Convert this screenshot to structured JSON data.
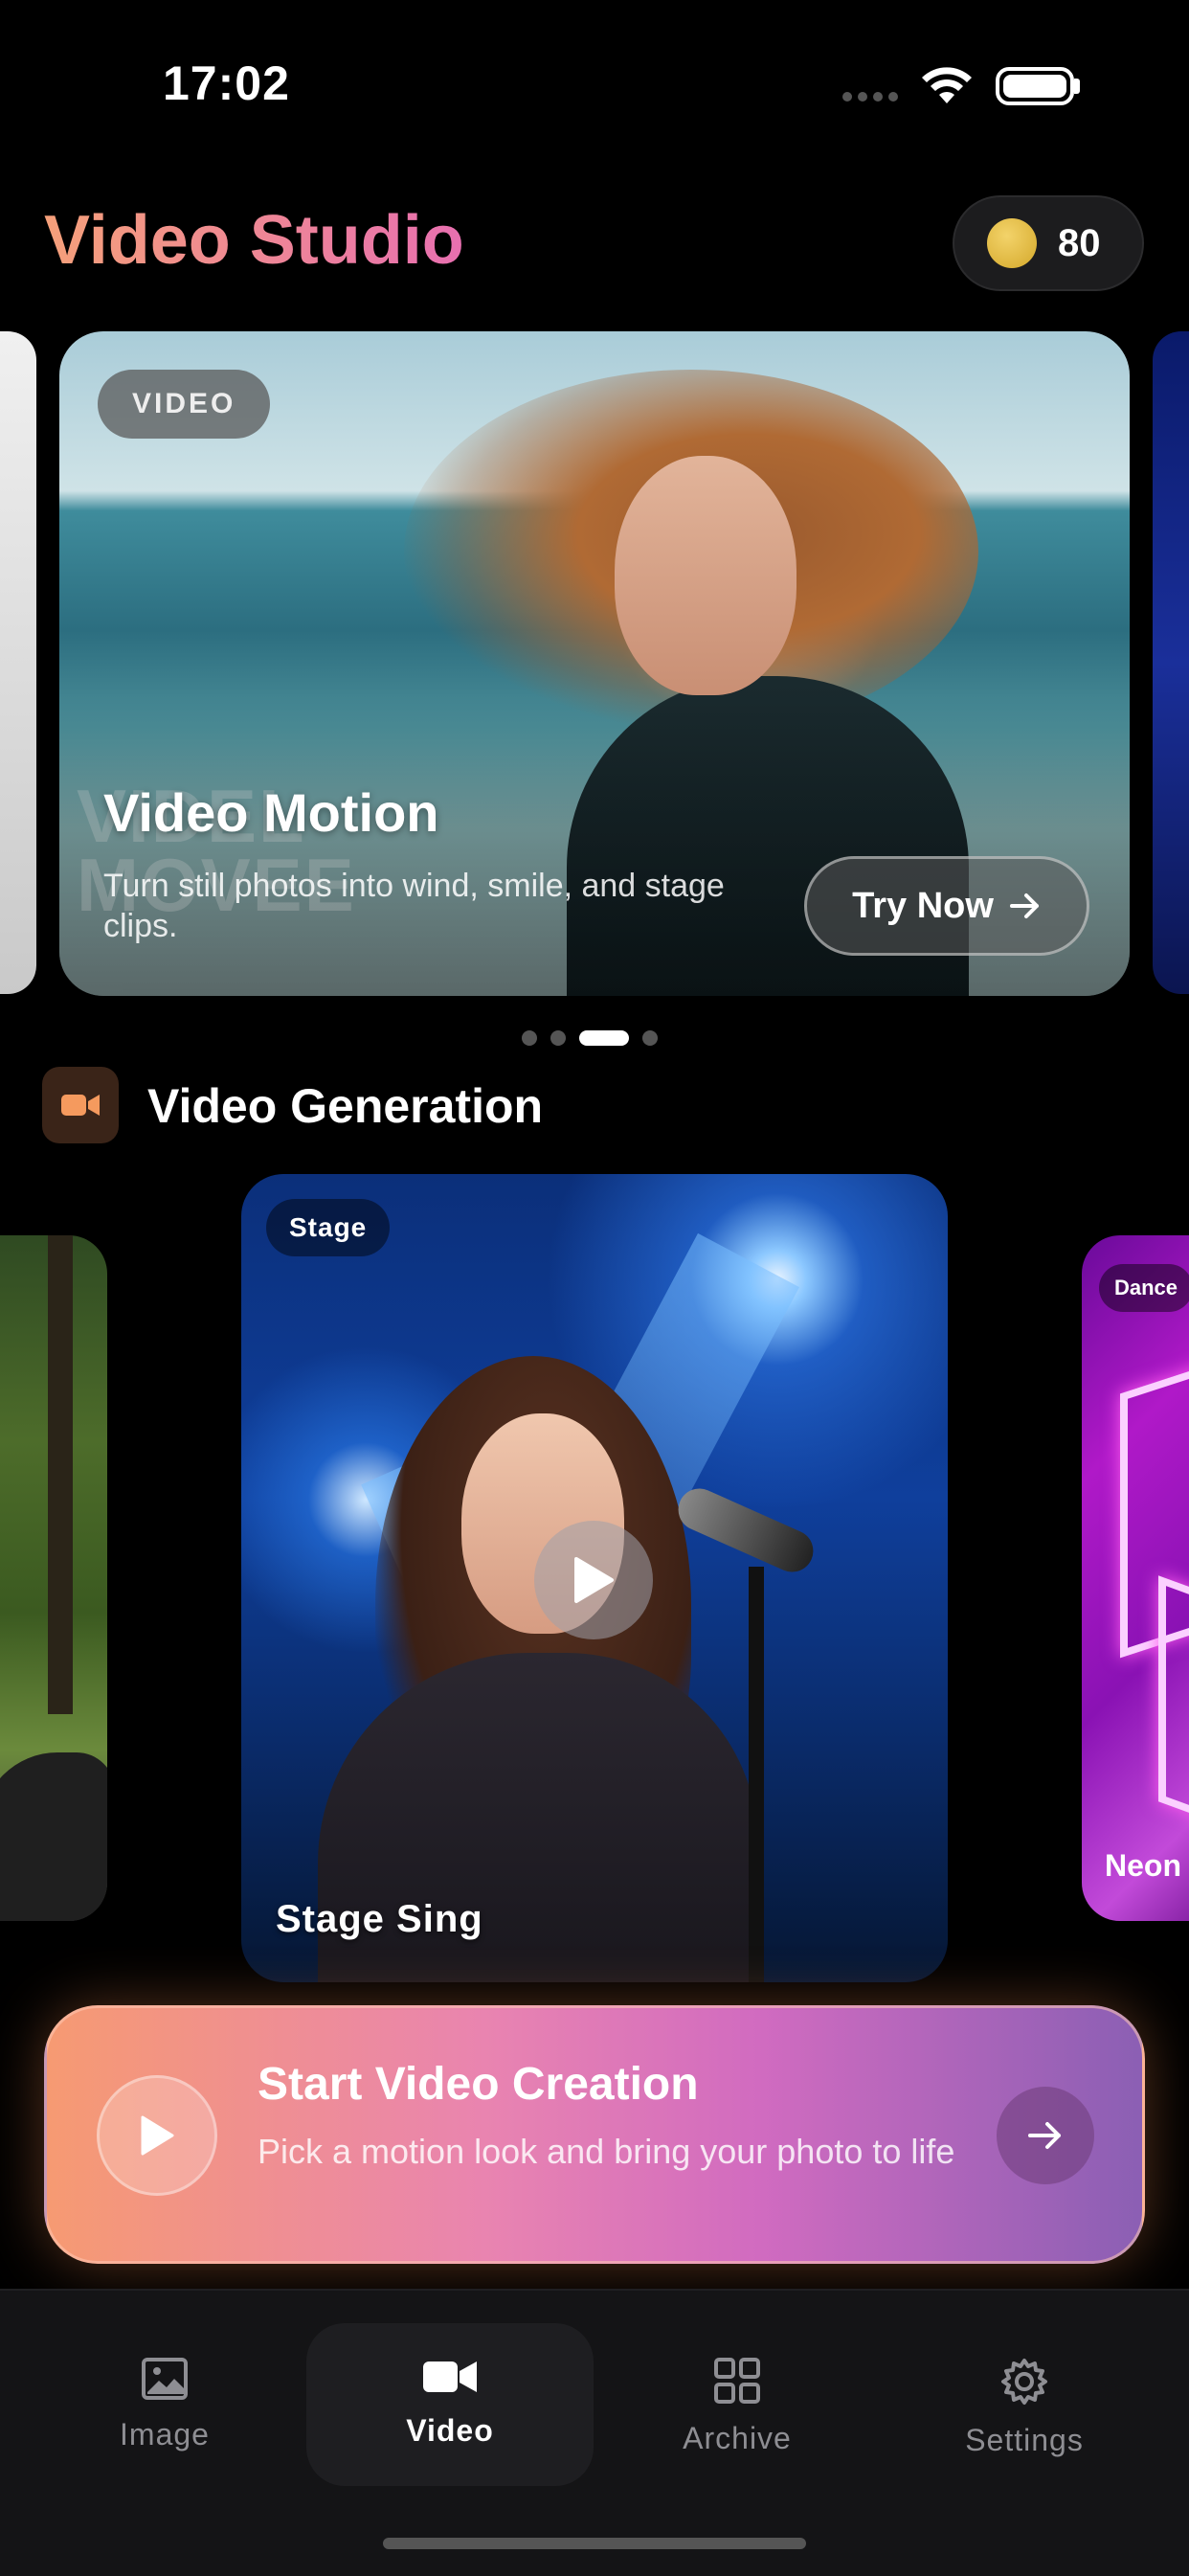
{
  "status_bar": {
    "time": "17:02"
  },
  "header": {
    "title": "Video Studio",
    "coins": "80"
  },
  "hero": {
    "tag": "VIDEO",
    "watermark_line1": "VIDEL",
    "watermark_line2": "MOVEE",
    "title": "Video Motion",
    "subtitle": "Turn still photos into wind, smile, and stage clips.",
    "button_label": "Try Now",
    "page_count": 4,
    "active_page": 3
  },
  "section": {
    "title": "Video Generation"
  },
  "video_cards": {
    "main": {
      "tag": "Stage",
      "name": "Stage Sing"
    },
    "right": {
      "tag": "Dance",
      "name": "Neon Pa"
    }
  },
  "cta": {
    "title": "Start Video Creation",
    "subtitle": "Pick a motion look and bring your photo to life"
  },
  "tabbar": {
    "tabs": [
      {
        "label": "Image",
        "icon": "image-icon"
      },
      {
        "label": "Video",
        "icon": "video-camera-icon",
        "active": true
      },
      {
        "label": "Archive",
        "icon": "grid-icon"
      },
      {
        "label": "Settings",
        "icon": "gear-icon"
      }
    ]
  },
  "colors": {
    "accent_orange": "#f5a07a",
    "accent_pink": "#e86fb0",
    "accent_purple": "#8b5fb4",
    "background": "#000000"
  }
}
